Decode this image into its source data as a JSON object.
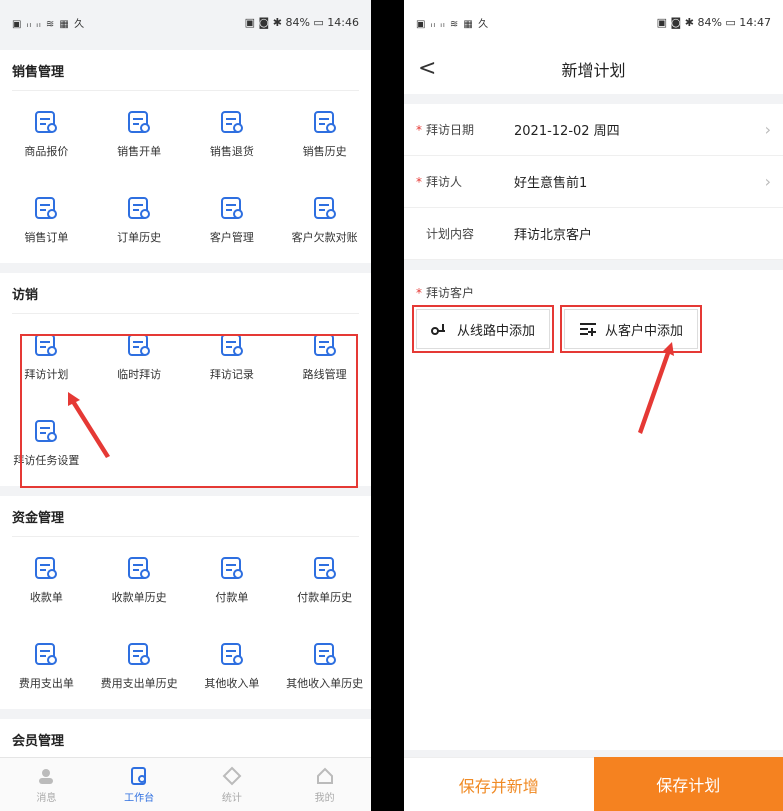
{
  "left_status": {
    "time": "14:46",
    "battery": "84%"
  },
  "right_status": {
    "time": "14:47",
    "battery": "84%"
  },
  "sales": {
    "title": "销售管理",
    "items": [
      {
        "label": "商品报价",
        "icon": "home-price-icon"
      },
      {
        "label": "销售开单",
        "icon": "sales-order-icon"
      },
      {
        "label": "销售退货",
        "icon": "sales-return-icon"
      },
      {
        "label": "销售历史",
        "icon": "sales-history-icon"
      },
      {
        "label": "销售订单",
        "icon": "sales-list-icon"
      },
      {
        "label": "订单历史",
        "icon": "order-history-icon"
      },
      {
        "label": "客户管理",
        "icon": "customer-icon"
      },
      {
        "label": "客户欠款对账",
        "icon": "debt-icon"
      }
    ]
  },
  "visit": {
    "title": "访销",
    "items": [
      {
        "label": "拜访计划",
        "icon": "visit-plan-icon"
      },
      {
        "label": "临时拜访",
        "icon": "calendar-icon"
      },
      {
        "label": "拜访记录",
        "icon": "visit-record-icon"
      },
      {
        "label": "路线管理",
        "icon": "route-icon"
      },
      {
        "label": "拜访任务设置",
        "icon": "task-settings-icon"
      }
    ]
  },
  "funds": {
    "title": "资金管理",
    "items": [
      {
        "label": "收款单",
        "icon": "receipt-icon"
      },
      {
        "label": "收款单历史",
        "icon": "receipt-history-icon"
      },
      {
        "label": "付款单",
        "icon": "payment-icon"
      },
      {
        "label": "付款单历史",
        "icon": "payment-history-icon"
      },
      {
        "label": "费用支出单",
        "icon": "expense-icon"
      },
      {
        "label": "费用支出单历史",
        "icon": "expense-history-icon"
      },
      {
        "label": "其他收入单",
        "icon": "income-icon"
      },
      {
        "label": "其他收入单历史",
        "icon": "income-history-icon"
      }
    ]
  },
  "member": {
    "title": "会员管理"
  },
  "tabs": [
    {
      "label": "消息",
      "icon": "message-icon"
    },
    {
      "label": "工作台",
      "icon": "workbench-icon"
    },
    {
      "label": "统计",
      "icon": "stats-icon"
    },
    {
      "label": "我的",
      "icon": "profile-icon"
    }
  ],
  "plan": {
    "nav_title": "新增计划",
    "back_symbol": "<",
    "rows": [
      {
        "key": "拜访日期",
        "value": "2021-12-02 周四",
        "required": "*",
        "has_chevron": true
      },
      {
        "key": "拜访人",
        "value": "好生意售前1",
        "required": "*",
        "has_chevron": true
      },
      {
        "key": "计划内容",
        "value": "拜访北京客户",
        "required": "",
        "has_chevron": false
      }
    ],
    "visit_customer_label": "拜访客户",
    "required_mark": "*",
    "add_from_route": "从线路中添加",
    "add_from_customer": "从客户中添加",
    "save_and_new": "保存并新增",
    "save": "保存计划",
    "chevron": "›"
  },
  "colors": {
    "accent_blue": "#2e6fe0",
    "orange": "#f58220",
    "highlight_red": "#e53935"
  }
}
